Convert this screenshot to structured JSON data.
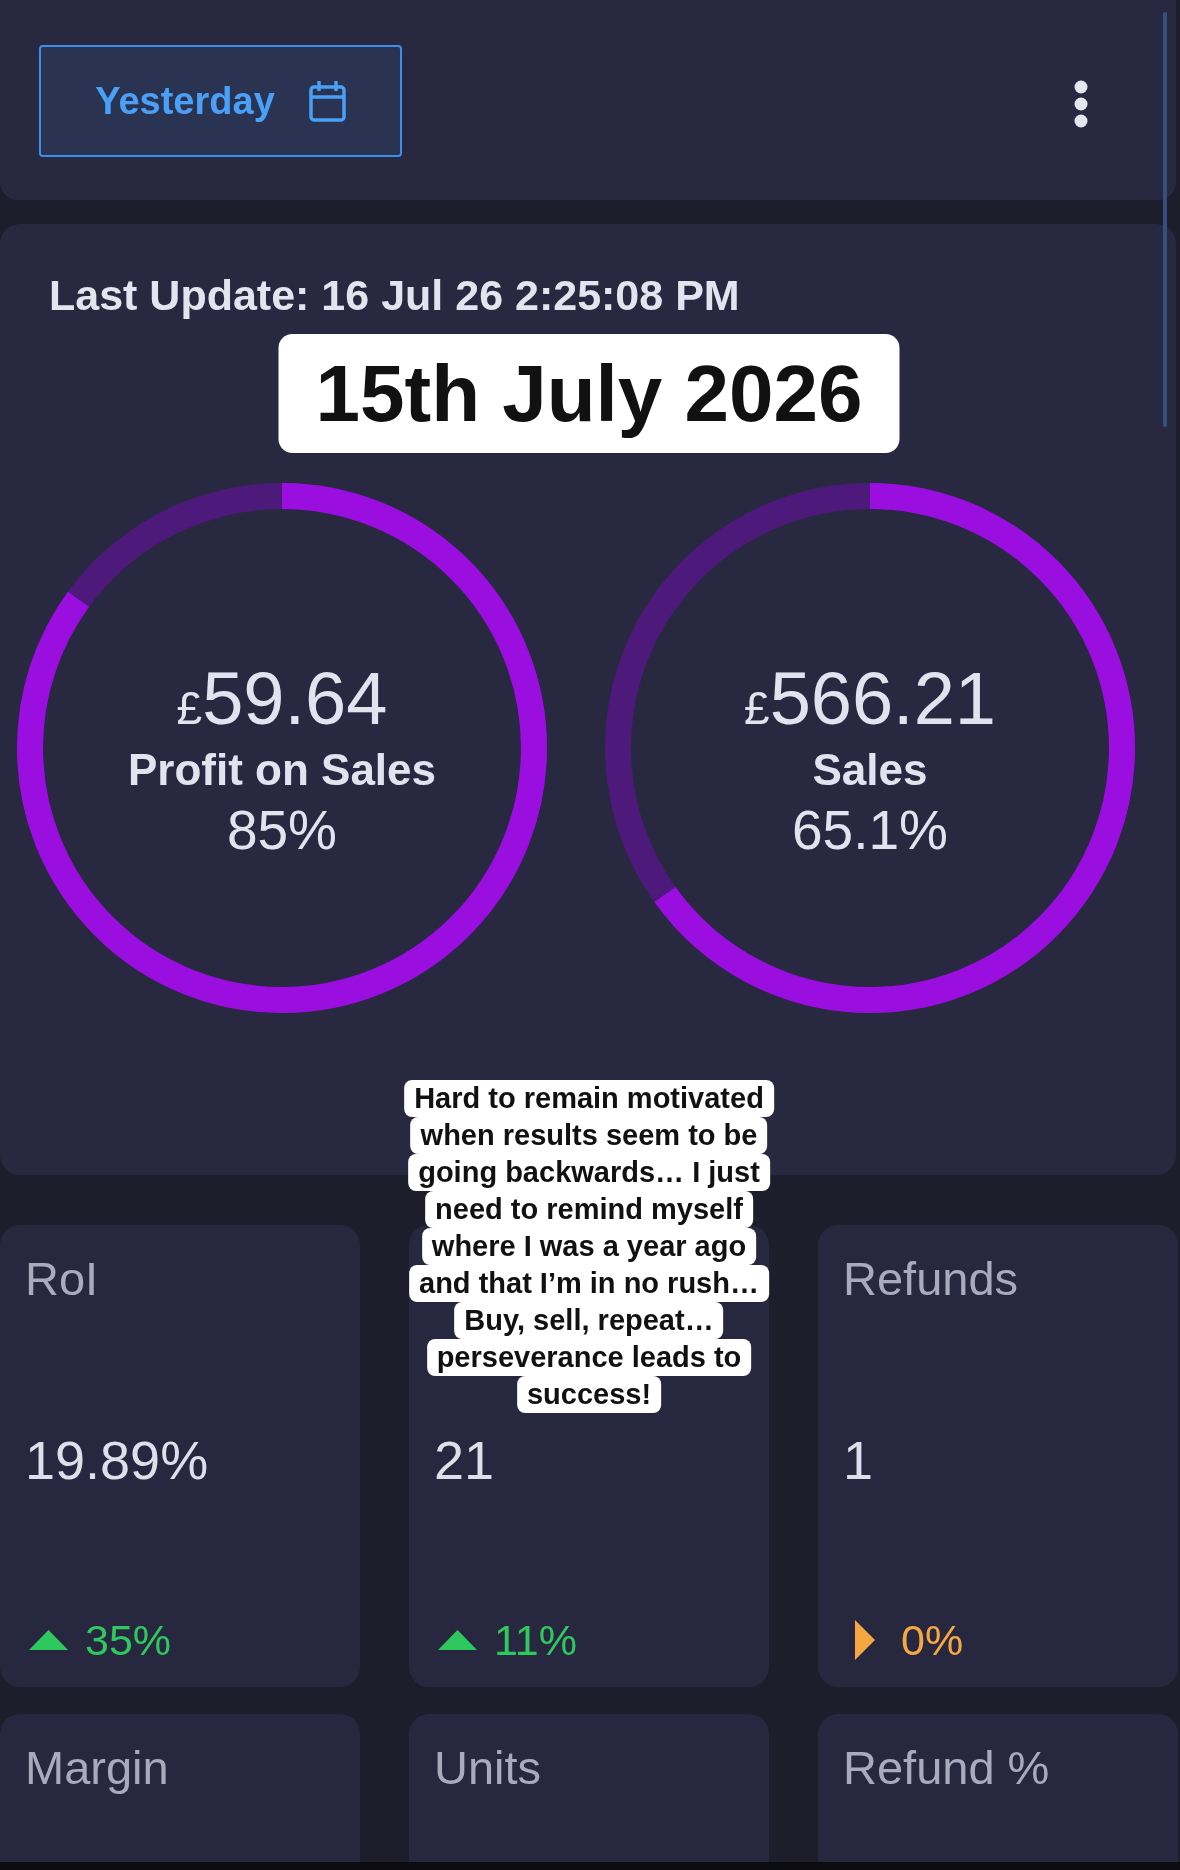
{
  "header": {
    "date_button": {
      "label": "Yesterday"
    }
  },
  "summary": {
    "last_update": "Last Update: 16 Jul 26 2:25:08 PM",
    "rings": [
      {
        "currency": "£",
        "amount": "59.64",
        "label": "Profit on Sales",
        "percent": "85%",
        "level": 0.85
      },
      {
        "currency": "£",
        "amount": "566.21",
        "label": "Sales",
        "percent": "65.1%",
        "level": 0.651
      }
    ]
  },
  "date_overlay": "15th July 2026",
  "caption": {
    "lines": [
      "Hard to remain motivated",
      "when results seem to be",
      "going backwards… I just",
      "need to remind myself",
      "where I was a year ago",
      "and that I’m in no rush…",
      "Buy, sell, repeat…",
      "perseverance leads to",
      "success!"
    ]
  },
  "kpi_cards": [
    {
      "title": "RoI",
      "value": "19.89%",
      "kind": "up",
      "change": "35%"
    },
    {
      "value": "21",
      "kind": "up",
      "change": "11%"
    },
    {
      "title": "Refunds",
      "value": "1",
      "kind": "flat",
      "change": "0%"
    },
    {
      "title": "Margin"
    },
    {
      "title": "Units"
    },
    {
      "title": "Refund %"
    }
  ]
}
